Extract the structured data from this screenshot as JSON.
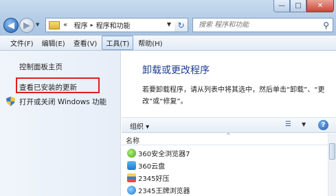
{
  "window": {
    "min_glyph": "—",
    "max_glyph": "□",
    "close_glyph": "✕"
  },
  "address": {
    "prefix": "«",
    "crumbs": [
      "程序",
      "程序和功能"
    ],
    "search_placeholder": "搜索 程序和功能"
  },
  "menu": {
    "items": [
      "文件(F)",
      "编辑(E)",
      "查看(V)",
      "工具(T)",
      "帮助(H)"
    ],
    "active_index": 3
  },
  "sidebar": {
    "home": "控制面板主页",
    "updates": "查看已安装的更新",
    "features": "打开或关闭 Windows 功能"
  },
  "main": {
    "title": "卸载或更改程序",
    "description": "若要卸载程序，请从列表中将其选中，然后单击“卸载”、“更改”或“修复”。",
    "organize": "组织 ▾",
    "column_name": "名称",
    "programs": [
      {
        "name": "360安全浏览器7",
        "icon": "browser-360-icon"
      },
      {
        "name": "360云盘",
        "icon": "cloud-360-icon"
      },
      {
        "name": "2345好压",
        "icon": "haozip-icon"
      },
      {
        "name": "2345王牌浏览器",
        "icon": "browser-2345-icon"
      }
    ]
  },
  "colors": {
    "highlight_box": "#e11d1d",
    "title_blue": "#1e3f8f"
  }
}
